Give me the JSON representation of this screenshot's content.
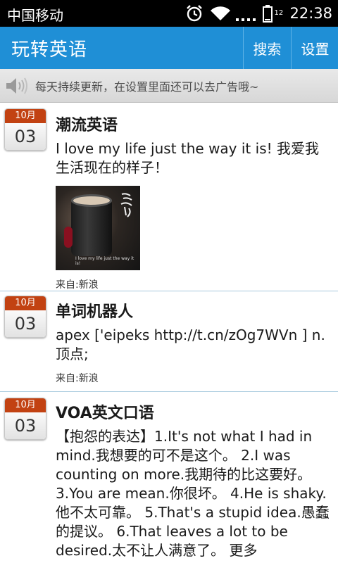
{
  "status_bar": {
    "carrier": "中国移动",
    "battery_percent": "12",
    "time": "22:38"
  },
  "app_bar": {
    "title": "玩转英语",
    "search_label": "搜索",
    "settings_label": "设置",
    "color": "#1f8fd6"
  },
  "notice": {
    "text": "每天持续更新，在设置里面还可以去广告哦~",
    "icon": "speaker-icon"
  },
  "feed": [
    {
      "month": "10月",
      "day": "03",
      "author": "潮流英语",
      "text": "I love my life just the way it is! 我爱我生活现在的样子！",
      "image_caption": "I love my life just the way it is!",
      "source": "来自:新浪"
    },
    {
      "month": "10月",
      "day": "03",
      "author": "单词机器人",
      "text": "apex ['eipeks http://t.cn/zOg7WVn ] n. 顶点;",
      "source": "来自:新浪"
    },
    {
      "month": "10月",
      "day": "03",
      "author": "VOA英文口语",
      "text": "【抱怨的表达】1.It's not what I had in mind.我想要的可不是这个。 2.I was counting on more.我期待的比这要好。 3.You are mean.你很坏。 4.He is shaky.他不太可靠。 5.That's a stupid idea.愚蠢的提议。 6.That leaves a lot to be desired.太不让人满意了。 更多"
    }
  ]
}
